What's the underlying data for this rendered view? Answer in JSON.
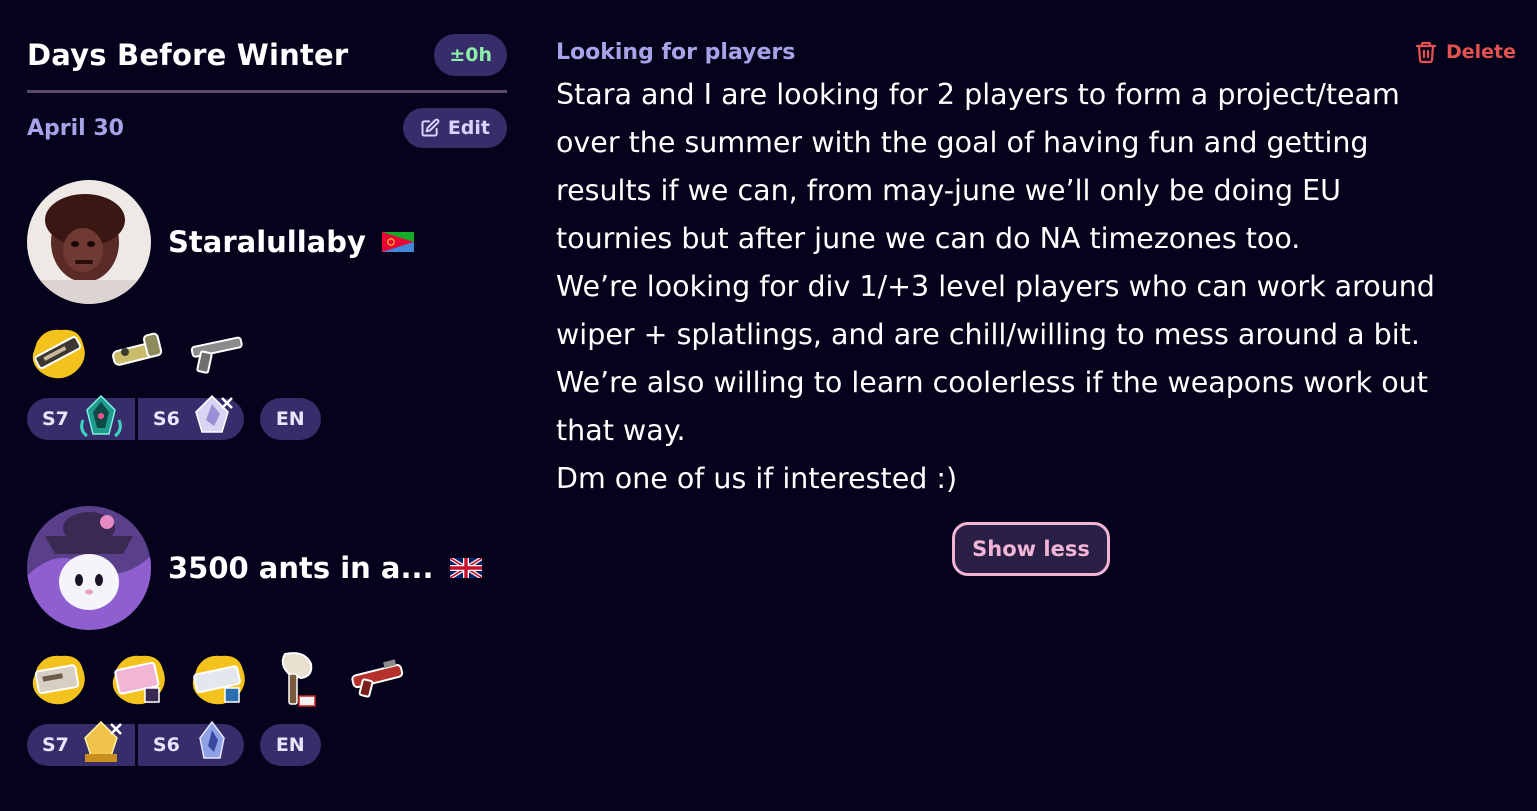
{
  "team": {
    "name": "Days Before Winter",
    "time_badge": "±0h",
    "date": "April 30",
    "edit_label": "Edit"
  },
  "members": [
    {
      "name": "Staralullaby",
      "flag": "eritrea-flag",
      "weapons": [
        "splatling-weapon-icon",
        "slosher-weapon-icon",
        "blaster-weapon-icon"
      ],
      "ranks": [
        {
          "season": "S7",
          "icon": "rank-crystal-teal-icon"
        },
        {
          "season": "S6",
          "icon": "rank-crystal-white-icon"
        }
      ],
      "language": "EN"
    },
    {
      "name": "3500 ants in a...",
      "flag": "uk-flag",
      "weapons": [
        "splatling-weapon-icon",
        "splatling-weapon-icon",
        "splatling-weapon-icon",
        "brush-weapon-icon",
        "shooter-weapon-icon"
      ],
      "ranks": [
        {
          "season": "S7",
          "icon": "rank-crystal-gold-icon"
        },
        {
          "season": "S6",
          "icon": "rank-crystal-blue-icon"
        }
      ],
      "language": "EN"
    }
  ],
  "post": {
    "type": "Looking for players",
    "delete_label": "Delete",
    "lines": [
      "Stara and I are looking for 2 players to form a project/team",
      "over the summer with the goal of having fun and getting",
      "results if we can, from may-june we’ll only be doing EU",
      "tournies but after june we can do NA timezones too.",
      "We’re looking for div 1/+3 level players who can work around",
      "wiper + splatlings, and are chill/willing to mess around a bit.",
      "We’re also willing to learn coolerless if the weapons work out",
      "that way.",
      "Dm one of us if interested :)"
    ],
    "show_less_label": "Show less"
  },
  "colors": {
    "background": "#05031c",
    "pill": "#362d6a",
    "accent_text": "#a7a3e8",
    "time_green": "#8ef0a8",
    "delete_red": "#e4534f",
    "show_less_pink": "#f3b5d6"
  }
}
